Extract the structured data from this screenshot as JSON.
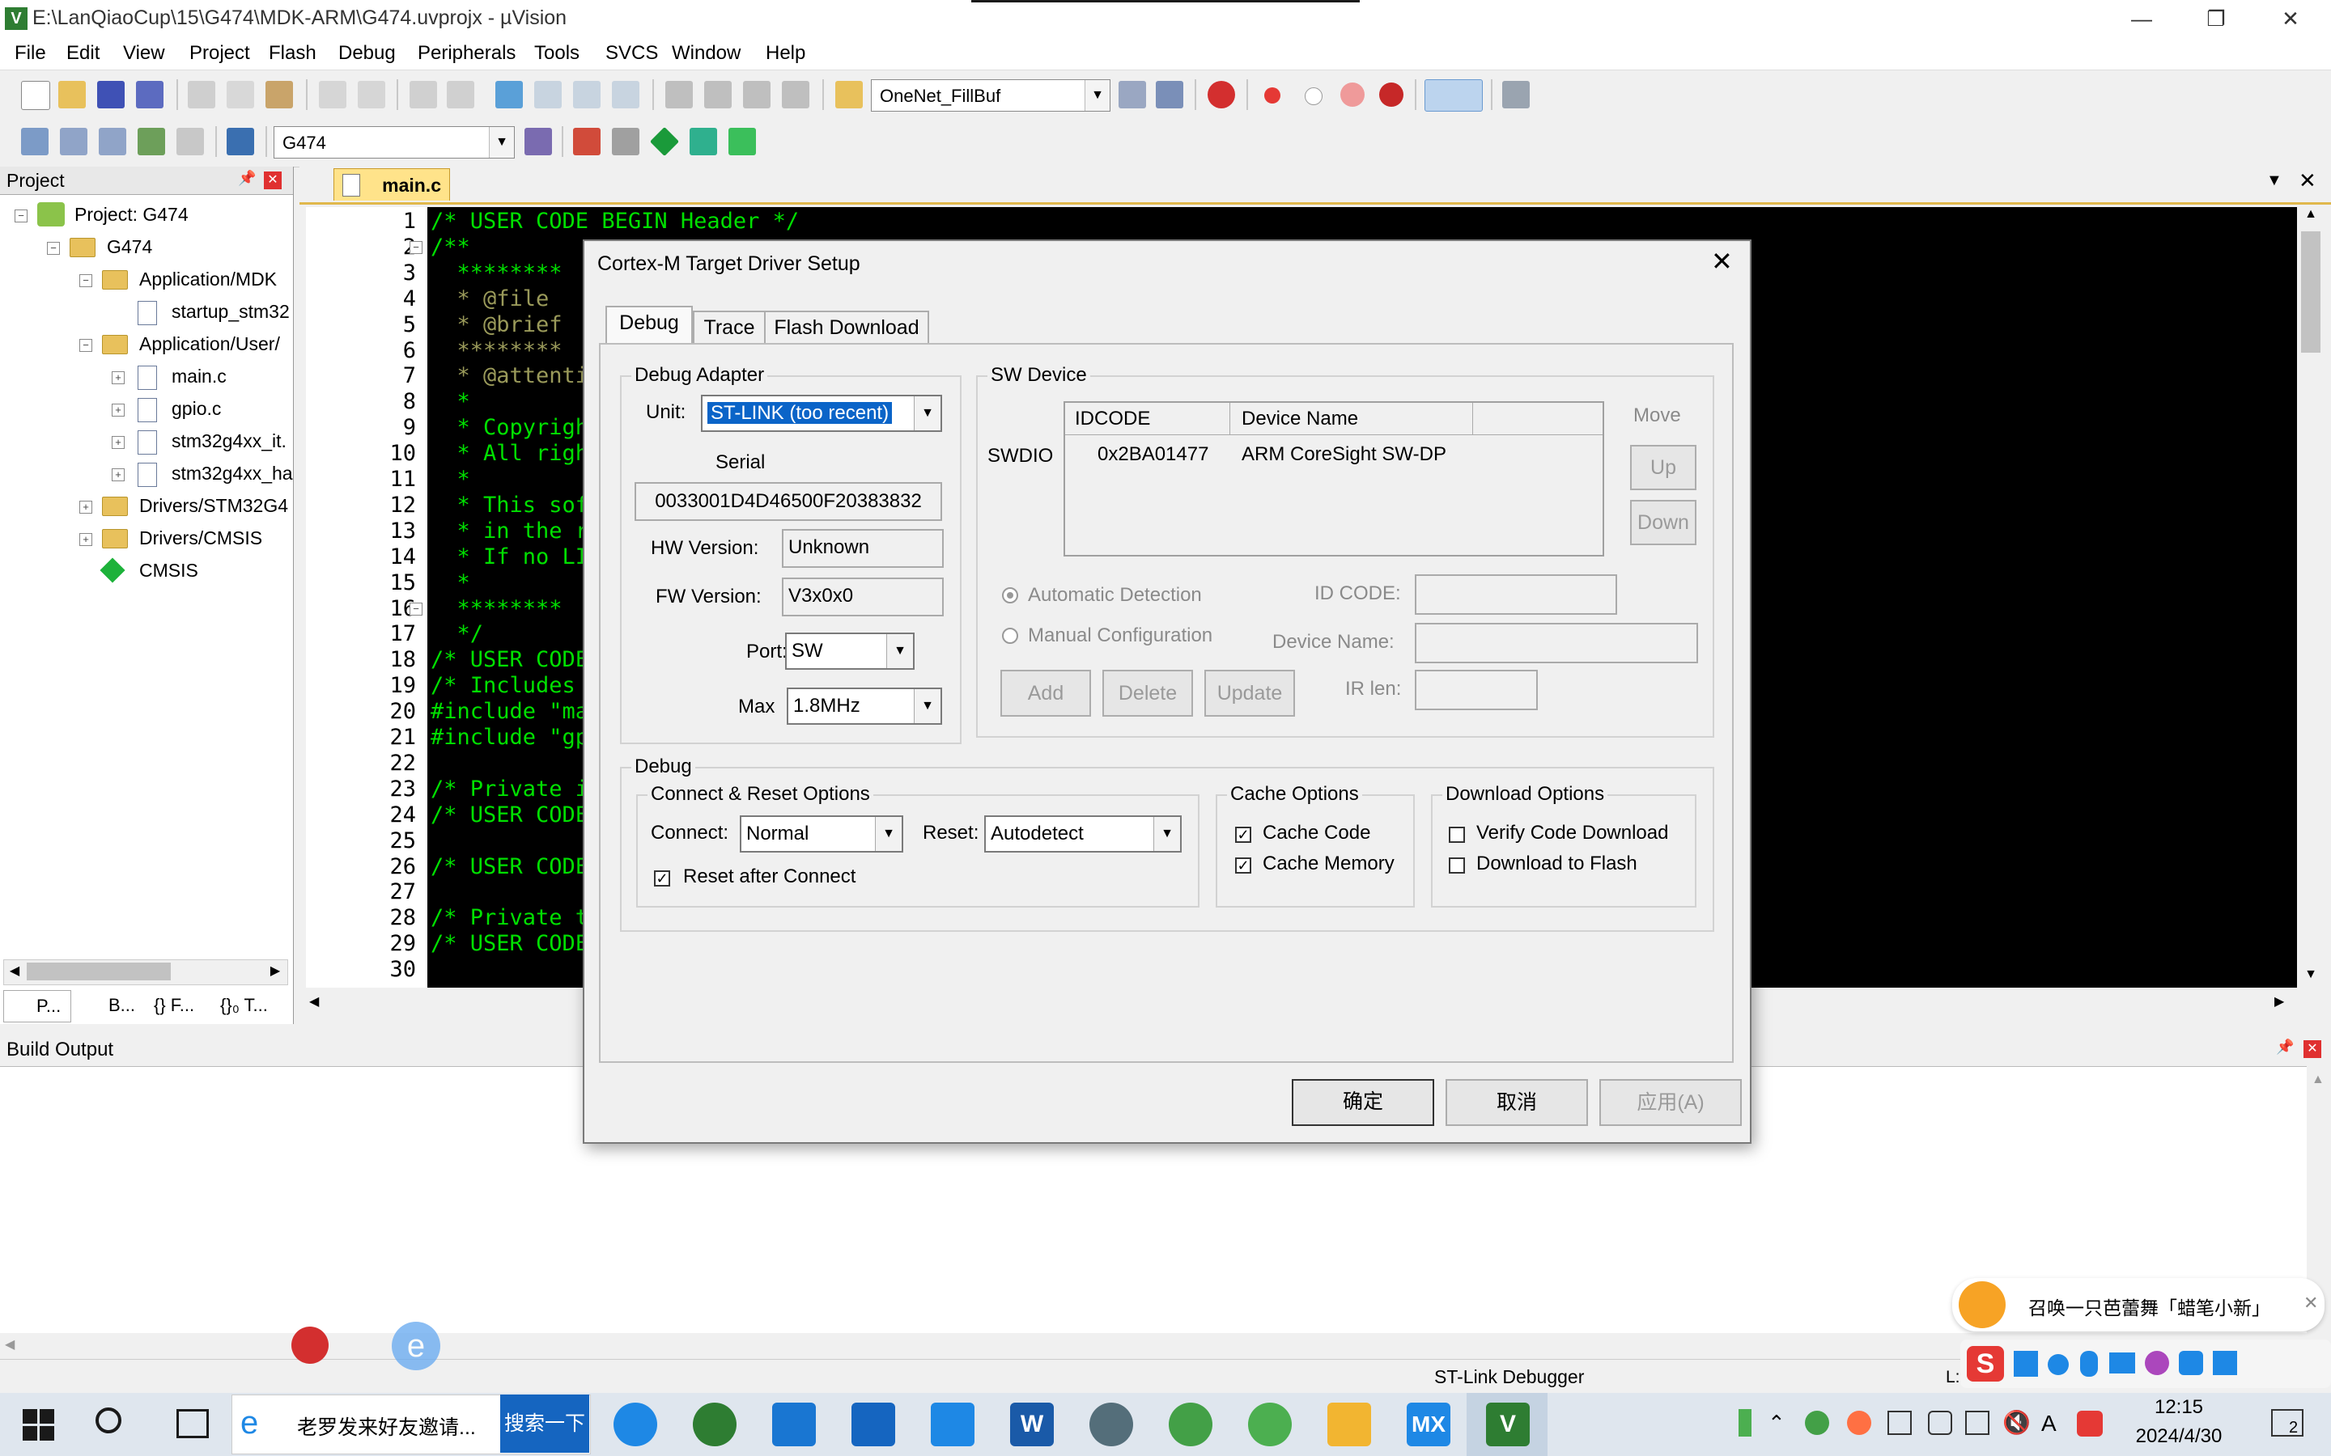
{
  "window": {
    "title": "E:\\LanQiaoCup\\15\\G474\\MDK-ARM\\G474.uvprojx - µVision",
    "app_icon": "V"
  },
  "menu": [
    "File",
    "Edit",
    "View",
    "Project",
    "Flash",
    "Debug",
    "Peripherals",
    "Tools",
    "SVCS",
    "Window",
    "Help"
  ],
  "toolbar": {
    "find_combo": "OneNet_FillBuf",
    "target_combo": "G474"
  },
  "project": {
    "header": "Project",
    "tree": [
      "Project: G474",
      "G474",
      "Application/MDK",
      "startup_stm32",
      "Application/User/",
      "main.c",
      "gpio.c",
      "stm32g4xx_it.",
      "stm32g4xx_ha",
      "Drivers/STM32G4",
      "Drivers/CMSIS",
      "CMSIS"
    ],
    "bottom_tabs": [
      "P...",
      "B...",
      "{} F...",
      "{}₀ T..."
    ]
  },
  "editor": {
    "tab": "main.c",
    "lines": [
      {
        "n": "1",
        "t": "/* USER CODE BEGIN Header */"
      },
      {
        "n": "2",
        "t": "/**"
      },
      {
        "n": "3",
        "t": "  ********"
      },
      {
        "n": "4",
        "t": "  * @file"
      },
      {
        "n": "5",
        "t": "  * @brief"
      },
      {
        "n": "6",
        "t": "  ********"
      },
      {
        "n": "7",
        "t": "  * @attenti"
      },
      {
        "n": "8",
        "t": "  *"
      },
      {
        "n": "9",
        "t": "  * Copyrigh"
      },
      {
        "n": "10",
        "t": "  * All righ"
      },
      {
        "n": "11",
        "t": "  *"
      },
      {
        "n": "12",
        "t": "  * This sof"
      },
      {
        "n": "13",
        "t": "  * in the r"
      },
      {
        "n": "14",
        "t": "  * If no LI"
      },
      {
        "n": "15",
        "t": "  *"
      },
      {
        "n": "16",
        "t": "  ********"
      },
      {
        "n": "17",
        "t": "  */"
      },
      {
        "n": "18",
        "t": "/* USER CODE"
      },
      {
        "n": "19",
        "t": "/* Includes"
      },
      {
        "n": "20",
        "t": "#include \"ma"
      },
      {
        "n": "21",
        "t": "#include \"gp"
      },
      {
        "n": "22",
        "t": ""
      },
      {
        "n": "23",
        "t": "/* Private i"
      },
      {
        "n": "24",
        "t": "/* USER CODE"
      },
      {
        "n": "25",
        "t": ""
      },
      {
        "n": "26",
        "t": "/* USER CODE"
      },
      {
        "n": "27",
        "t": ""
      },
      {
        "n": "28",
        "t": "/* Private t"
      },
      {
        "n": "29",
        "t": "/* USER CODE"
      },
      {
        "n": "30",
        "t": ""
      }
    ]
  },
  "build": {
    "header": "Build Output"
  },
  "status": {
    "debugger": "ST-Link Debugger",
    "pos": "L:1"
  },
  "dialog": {
    "title": "Cortex-M Target Driver Setup",
    "tabs": [
      "Debug",
      "Trace",
      "Flash Download"
    ],
    "debug_adapter": {
      "legend": "Debug Adapter",
      "unit_label": "Unit:",
      "unit_value": "ST-LINK (too recent)",
      "serial_label": "Serial",
      "serial_value": "0033001D4D46500F20383832",
      "hw_label": "HW Version:",
      "hw_value": "Unknown",
      "fw_label": "FW Version:",
      "fw_value": "V3x0x0",
      "port_label": "Port:",
      "port_value": "SW",
      "max_label": "Max",
      "max_value": "1.8MHz"
    },
    "sw_device": {
      "legend": "SW Device",
      "col_idcode": "IDCODE",
      "col_name": "Device Name",
      "row_label": "SWDIO",
      "row_idcode": "0x2BA01477",
      "row_name": "ARM CoreSight SW-DP",
      "move": "Move",
      "up": "Up",
      "down": "Down",
      "auto": "Automatic Detection",
      "manual": "Manual Configuration",
      "idcode_label": "ID CODE:",
      "devname_label": "Device Name:",
      "irlen_label": "IR len:",
      "add": "Add",
      "delete": "Delete",
      "update": "Update"
    },
    "debug": {
      "legend": "Debug",
      "cr_legend": "Connect & Reset Options",
      "connect_label": "Connect:",
      "connect_value": "Normal",
      "reset_label": "Reset:",
      "reset_value": "Autodetect",
      "reset_after": "Reset after Connect",
      "cache_legend": "Cache Options",
      "cache_code": "Cache Code",
      "cache_memory": "Cache Memory",
      "dl_legend": "Download Options",
      "verify": "Verify Code Download",
      "dl_flash": "Download to Flash"
    },
    "buttons": {
      "ok": "确定",
      "cancel": "取消",
      "apply": "应用(A)"
    }
  },
  "ime": {
    "text": "召唤一只芭蕾舞「蜡笔小新」"
  },
  "taskbar": {
    "search_text": "老罗发来好友邀请...",
    "search_button": "搜索一下",
    "time": "12:15",
    "date": "2024/4/30",
    "notif_count": "2",
    "ime_a": "A"
  },
  "colors": {
    "accent": "#1565c0",
    "code_fg": "#00e000",
    "tab_active": "#ffe38a"
  }
}
